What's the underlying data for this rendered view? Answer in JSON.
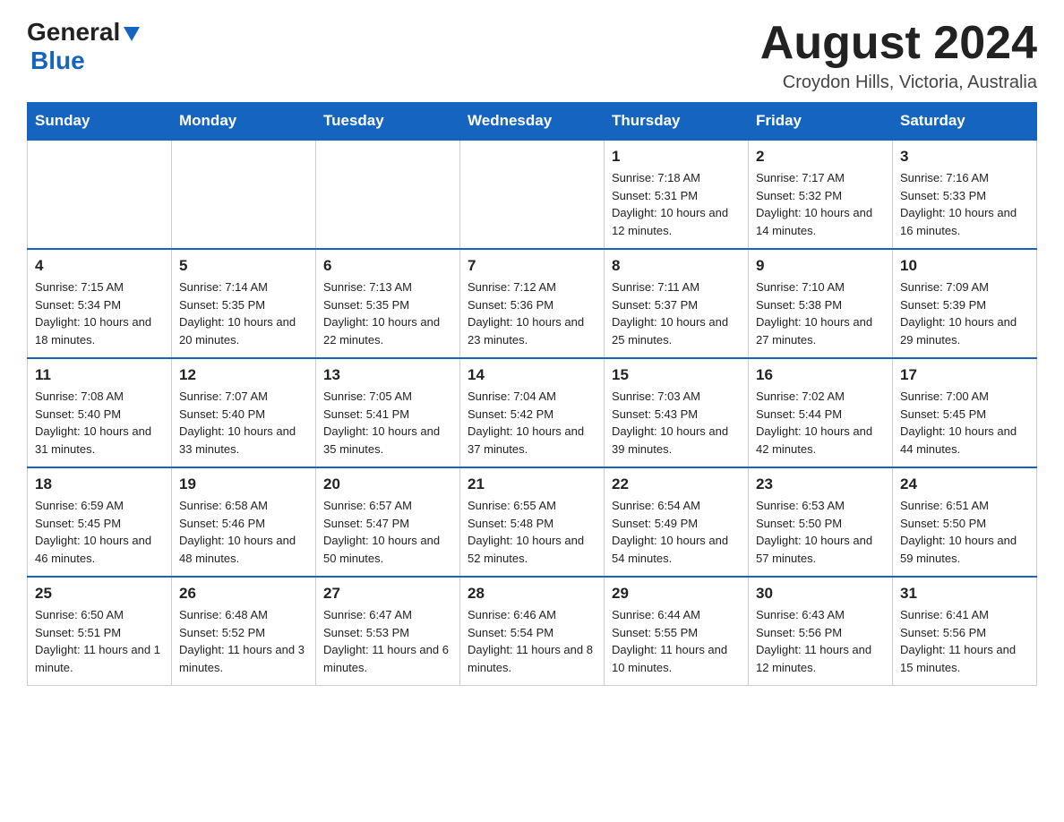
{
  "header": {
    "logo_general": "General",
    "logo_blue": "Blue",
    "title": "August 2024",
    "subtitle": "Croydon Hills, Victoria, Australia"
  },
  "calendar": {
    "days_of_week": [
      "Sunday",
      "Monday",
      "Tuesday",
      "Wednesday",
      "Thursday",
      "Friday",
      "Saturday"
    ],
    "weeks": [
      {
        "days": [
          {
            "num": "",
            "info": ""
          },
          {
            "num": "",
            "info": ""
          },
          {
            "num": "",
            "info": ""
          },
          {
            "num": "",
            "info": ""
          },
          {
            "num": "1",
            "info": "Sunrise: 7:18 AM\nSunset: 5:31 PM\nDaylight: 10 hours and 12 minutes."
          },
          {
            "num": "2",
            "info": "Sunrise: 7:17 AM\nSunset: 5:32 PM\nDaylight: 10 hours and 14 minutes."
          },
          {
            "num": "3",
            "info": "Sunrise: 7:16 AM\nSunset: 5:33 PM\nDaylight: 10 hours and 16 minutes."
          }
        ]
      },
      {
        "days": [
          {
            "num": "4",
            "info": "Sunrise: 7:15 AM\nSunset: 5:34 PM\nDaylight: 10 hours and 18 minutes."
          },
          {
            "num": "5",
            "info": "Sunrise: 7:14 AM\nSunset: 5:35 PM\nDaylight: 10 hours and 20 minutes."
          },
          {
            "num": "6",
            "info": "Sunrise: 7:13 AM\nSunset: 5:35 PM\nDaylight: 10 hours and 22 minutes."
          },
          {
            "num": "7",
            "info": "Sunrise: 7:12 AM\nSunset: 5:36 PM\nDaylight: 10 hours and 23 minutes."
          },
          {
            "num": "8",
            "info": "Sunrise: 7:11 AM\nSunset: 5:37 PM\nDaylight: 10 hours and 25 minutes."
          },
          {
            "num": "9",
            "info": "Sunrise: 7:10 AM\nSunset: 5:38 PM\nDaylight: 10 hours and 27 minutes."
          },
          {
            "num": "10",
            "info": "Sunrise: 7:09 AM\nSunset: 5:39 PM\nDaylight: 10 hours and 29 minutes."
          }
        ]
      },
      {
        "days": [
          {
            "num": "11",
            "info": "Sunrise: 7:08 AM\nSunset: 5:40 PM\nDaylight: 10 hours and 31 minutes."
          },
          {
            "num": "12",
            "info": "Sunrise: 7:07 AM\nSunset: 5:40 PM\nDaylight: 10 hours and 33 minutes."
          },
          {
            "num": "13",
            "info": "Sunrise: 7:05 AM\nSunset: 5:41 PM\nDaylight: 10 hours and 35 minutes."
          },
          {
            "num": "14",
            "info": "Sunrise: 7:04 AM\nSunset: 5:42 PM\nDaylight: 10 hours and 37 minutes."
          },
          {
            "num": "15",
            "info": "Sunrise: 7:03 AM\nSunset: 5:43 PM\nDaylight: 10 hours and 39 minutes."
          },
          {
            "num": "16",
            "info": "Sunrise: 7:02 AM\nSunset: 5:44 PM\nDaylight: 10 hours and 42 minutes."
          },
          {
            "num": "17",
            "info": "Sunrise: 7:00 AM\nSunset: 5:45 PM\nDaylight: 10 hours and 44 minutes."
          }
        ]
      },
      {
        "days": [
          {
            "num": "18",
            "info": "Sunrise: 6:59 AM\nSunset: 5:45 PM\nDaylight: 10 hours and 46 minutes."
          },
          {
            "num": "19",
            "info": "Sunrise: 6:58 AM\nSunset: 5:46 PM\nDaylight: 10 hours and 48 minutes."
          },
          {
            "num": "20",
            "info": "Sunrise: 6:57 AM\nSunset: 5:47 PM\nDaylight: 10 hours and 50 minutes."
          },
          {
            "num": "21",
            "info": "Sunrise: 6:55 AM\nSunset: 5:48 PM\nDaylight: 10 hours and 52 minutes."
          },
          {
            "num": "22",
            "info": "Sunrise: 6:54 AM\nSunset: 5:49 PM\nDaylight: 10 hours and 54 minutes."
          },
          {
            "num": "23",
            "info": "Sunrise: 6:53 AM\nSunset: 5:50 PM\nDaylight: 10 hours and 57 minutes."
          },
          {
            "num": "24",
            "info": "Sunrise: 6:51 AM\nSunset: 5:50 PM\nDaylight: 10 hours and 59 minutes."
          }
        ]
      },
      {
        "days": [
          {
            "num": "25",
            "info": "Sunrise: 6:50 AM\nSunset: 5:51 PM\nDaylight: 11 hours and 1 minute."
          },
          {
            "num": "26",
            "info": "Sunrise: 6:48 AM\nSunset: 5:52 PM\nDaylight: 11 hours and 3 minutes."
          },
          {
            "num": "27",
            "info": "Sunrise: 6:47 AM\nSunset: 5:53 PM\nDaylight: 11 hours and 6 minutes."
          },
          {
            "num": "28",
            "info": "Sunrise: 6:46 AM\nSunset: 5:54 PM\nDaylight: 11 hours and 8 minutes."
          },
          {
            "num": "29",
            "info": "Sunrise: 6:44 AM\nSunset: 5:55 PM\nDaylight: 11 hours and 10 minutes."
          },
          {
            "num": "30",
            "info": "Sunrise: 6:43 AM\nSunset: 5:56 PM\nDaylight: 11 hours and 12 minutes."
          },
          {
            "num": "31",
            "info": "Sunrise: 6:41 AM\nSunset: 5:56 PM\nDaylight: 11 hours and 15 minutes."
          }
        ]
      }
    ]
  }
}
